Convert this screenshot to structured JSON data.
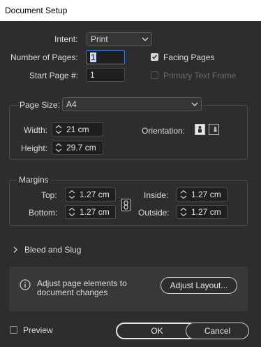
{
  "window": {
    "title": "Document Setup"
  },
  "intent": {
    "label": "Intent:",
    "value": "Print"
  },
  "pages": {
    "number_label": "Number of Pages:",
    "number_value": "1",
    "start_label": "Start Page #:",
    "start_value": "1"
  },
  "options": {
    "facing_pages": {
      "label": "Facing Pages",
      "checked": true
    },
    "primary_text_frame": {
      "label": "Primary Text Frame",
      "checked": false,
      "enabled": false
    }
  },
  "page_size": {
    "label": "Page Size:",
    "value": "A4",
    "width_label": "Width:",
    "width_value": "21 cm",
    "height_label": "Height:",
    "height_value": "29.7 cm",
    "orientation_label": "Orientation:",
    "orientation_selected": "portrait"
  },
  "margins": {
    "group_label": "Margins",
    "top_label": "Top:",
    "top_value": "1.27 cm",
    "bottom_label": "Bottom:",
    "bottom_value": "1.27 cm",
    "inside_label": "Inside:",
    "inside_value": "1.27 cm",
    "outside_label": "Outside:",
    "outside_value": "1.27 cm"
  },
  "bleed": {
    "label": "Bleed and Slug"
  },
  "info": {
    "text_line1": "Adjust page elements to",
    "text_line2": "document changes",
    "button": "Adjust Layout..."
  },
  "footer": {
    "preview_label": "Preview",
    "preview_checked": false,
    "ok": "OK",
    "cancel": "Cancel"
  },
  "colors": {
    "background": "#2d2d2d",
    "focus": "#3d7ae0",
    "text": "#dcdcdc"
  }
}
